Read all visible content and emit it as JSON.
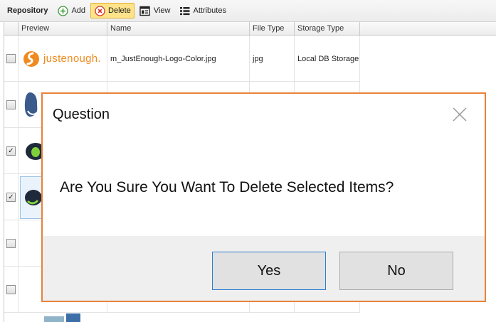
{
  "toolbar": {
    "title": "Repository",
    "add_label": "Add",
    "delete_label": "Delete",
    "view_label": "View",
    "attributes_label": "Attributes"
  },
  "grid": {
    "columns": [
      "Preview",
      "Name",
      "File Type",
      "Storage Type"
    ],
    "rows": [
      {
        "checked": false,
        "logo": "justenough.",
        "name": "m_JustEnough-Logo-Color.jpg",
        "file_type": "jpg",
        "storage_type": "Local DB Storage"
      },
      {
        "checked": false,
        "thumb": "sneaker-icon"
      },
      {
        "checked": true,
        "thumb": "sneaker-icon"
      },
      {
        "checked": true,
        "thumb": "sneaker-icon"
      },
      {
        "checked": false
      },
      {
        "checked": false
      }
    ]
  },
  "dialog": {
    "title": "Question",
    "message": "Are You Sure You Want To Delete Selected Items?",
    "yes_label": "Yes",
    "no_label": "No"
  },
  "colors": {
    "dialog_border": "#e8823a",
    "primary_button_border": "#2b7fd0",
    "delete_highlight": "#ffe38a",
    "add_icon": "#3a9a3a",
    "delete_icon": "#d2372c"
  }
}
